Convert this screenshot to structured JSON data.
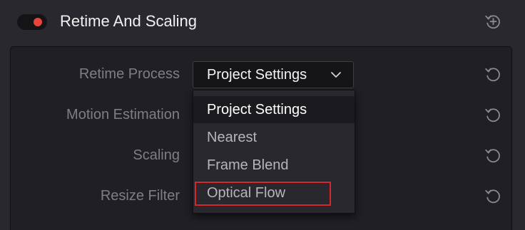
{
  "header": {
    "title": "Retime And Scaling",
    "toggle_state": "on",
    "toggle_color": "#e8463c"
  },
  "rows": [
    {
      "label": "Retime Process"
    },
    {
      "label": "Motion Estimation"
    },
    {
      "label": "Scaling"
    },
    {
      "label": "Resize Filter"
    }
  ],
  "retime_select": {
    "value": "Project Settings",
    "options": [
      "Project Settings",
      "Nearest",
      "Frame Blend",
      "Optical Flow"
    ],
    "highlighted_option": "Optical Flow",
    "highlight_color": "#d8262b"
  },
  "icons": {
    "header_reset": "add-keyframe-icon",
    "row_reset": "reset-icon",
    "select_chevron": "chevron-down-icon"
  }
}
